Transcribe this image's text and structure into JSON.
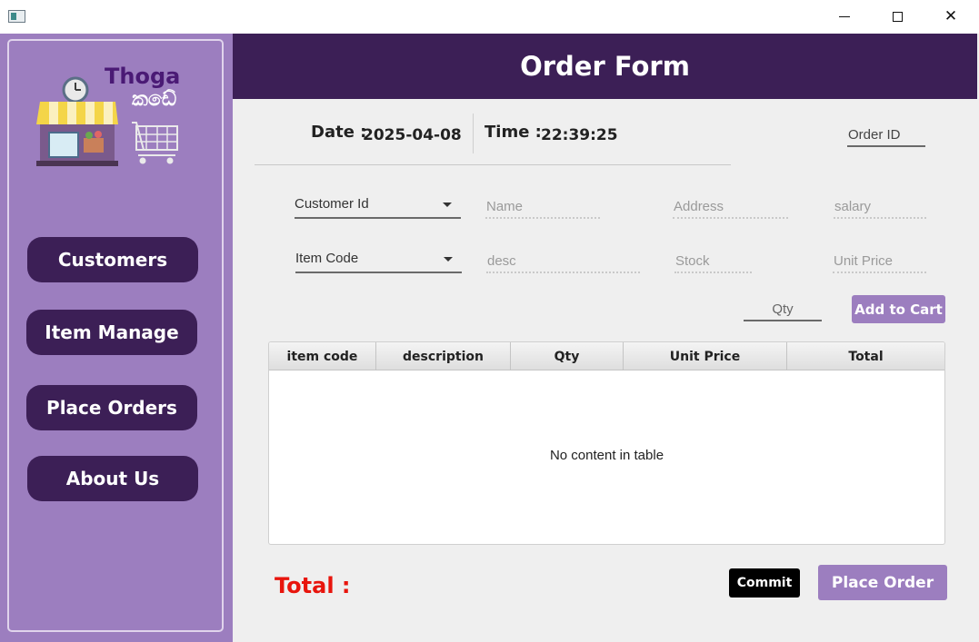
{
  "window": {
    "minimize_icon": "minimize-icon",
    "maximize_icon": "maximize-icon",
    "close_glyph": "✕"
  },
  "sidebar": {
    "logo_title": "Thoga",
    "logo_subtitle": "කඩේ",
    "items": [
      {
        "label": "Customers"
      },
      {
        "label": "Item Manage"
      },
      {
        "label": "Place Orders"
      },
      {
        "label": "About Us"
      }
    ]
  },
  "header": {
    "title": "Order Form"
  },
  "datetime": {
    "date_label": "Date :",
    "date_value": "2025-04-08",
    "time_label": "Time :",
    "time_value": "22:39:25"
  },
  "order": {
    "order_id_placeholder": "Order ID"
  },
  "customer": {
    "id_placeholder": "Customer Id",
    "name_placeholder": "Name",
    "address_placeholder": "Address",
    "salary_placeholder": "salary"
  },
  "item": {
    "code_placeholder": "Item Code",
    "desc_placeholder": "desc",
    "stock_placeholder": "Stock",
    "unit_price_placeholder": "Unit Price"
  },
  "cart": {
    "qty_placeholder": "Qty",
    "add_label": "Add to Cart"
  },
  "table": {
    "columns": [
      "item code",
      "description",
      "Qty",
      "Unit Price",
      "Total"
    ],
    "rows": [],
    "empty_message": "No content in table"
  },
  "footer": {
    "total_label": "Total :",
    "commit_label": "Commit",
    "place_order_label": "Place Order"
  },
  "colors": {
    "accent_dark": "#3c1f56",
    "accent_light": "#9c7ebf",
    "total_red": "#e8150d"
  }
}
